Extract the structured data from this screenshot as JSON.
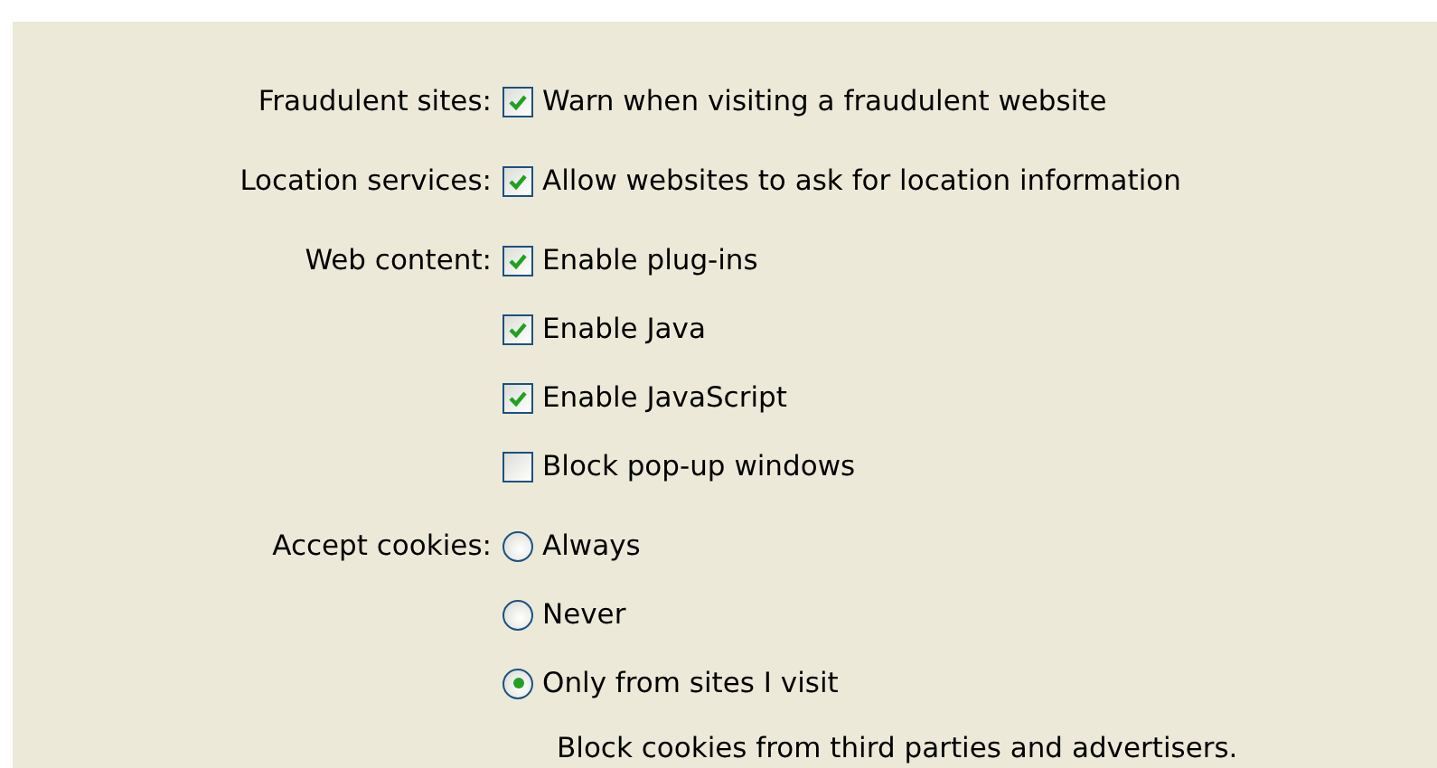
{
  "sections": [
    {
      "label": "Fraudulent sites:",
      "kind": "checkbox",
      "options": [
        {
          "text": "Warn when visiting a fraudulent website",
          "checked": true
        }
      ]
    },
    {
      "label": "Location services:",
      "kind": "checkbox",
      "options": [
        {
          "text": "Allow websites to ask for location information",
          "checked": true
        }
      ]
    },
    {
      "label": "Web content:",
      "kind": "checkbox",
      "options": [
        {
          "text": "Enable plug-ins",
          "checked": true
        },
        {
          "text": "Enable Java",
          "checked": true
        },
        {
          "text": "Enable JavaScript",
          "checked": true
        },
        {
          "text": "Block pop-up windows",
          "checked": false
        }
      ]
    },
    {
      "label": "Accept cookies:",
      "kind": "radio",
      "options": [
        {
          "text": "Always",
          "selected": false
        },
        {
          "text": "Never",
          "selected": false
        },
        {
          "text": "Only from sites I visit",
          "selected": true
        }
      ],
      "note": "Block cookies from third parties and advertisers."
    }
  ]
}
